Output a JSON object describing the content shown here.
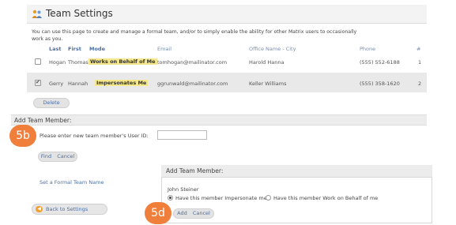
{
  "page": {
    "title": "Team Settings",
    "description": "You can use this page to create and manage a formal team, and/or to simply enable the ability for other Matrix users to occasionally work as you."
  },
  "table": {
    "headers": {
      "last": "Last",
      "first": "First",
      "mode": "Mode",
      "email": "Email",
      "office": "Office Name - City",
      "phone": "Phone",
      "num": "#"
    },
    "rows": [
      {
        "checked": false,
        "last": "Hogan",
        "first": "Thomas",
        "mode": "Works on Behalf of Me",
        "email": "tomhogan@mailinator.com",
        "office": "Harold Hanna",
        "phone": "(555) 552-6188",
        "num": "1"
      },
      {
        "checked": true,
        "last": "Gerry",
        "first": "Hannah",
        "mode": "Impersonates Me",
        "email": "ggrunwald@mailinator.com",
        "office": "Keller Williams",
        "phone": "(555) 358-1620",
        "num": "2"
      }
    ],
    "delete_label": "Delete"
  },
  "add_member": {
    "heading": "Add Team Member:",
    "prompt": "Please enter new team member's User ID:",
    "user_id_value": "",
    "find_label": "Find",
    "cancel_label": "Cancel",
    "formal_team_link": "Set a Formal Team Name"
  },
  "badges": {
    "b1": "5b",
    "b2": "5d"
  },
  "popup": {
    "heading": "Add Team Member:",
    "member_name": "John Steiner",
    "option1": "Have this member Impersonate me",
    "option2": "Have this member Work on Behalf of me",
    "selected_option": 1,
    "add_label": "Add",
    "cancel_label": "Cancel"
  },
  "back_label": "Back to Settings",
  "colors": {
    "badge": "#f07f3c",
    "mode_highlight": "#f4e78c",
    "link": "#4a6fa5"
  }
}
